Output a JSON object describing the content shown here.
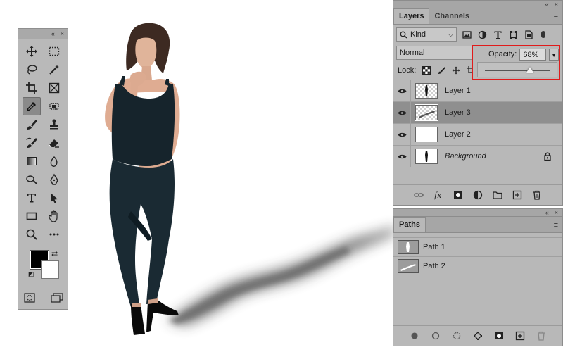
{
  "tools_panel": {
    "collapse_glyph": "«",
    "close_glyph": "×",
    "tools": [
      {
        "name": "move-tool-icon"
      },
      {
        "name": "rect-marquee-icon"
      },
      {
        "name": "lasso-icon"
      },
      {
        "name": "magic-wand-icon"
      },
      {
        "name": "crop-icon"
      },
      {
        "name": "frame-icon"
      },
      {
        "name": "eyedropper-icon",
        "active": true
      },
      {
        "name": "spot-healing-icon"
      },
      {
        "name": "brush-icon"
      },
      {
        "name": "clone-stamp-icon"
      },
      {
        "name": "history-brush-icon"
      },
      {
        "name": "eraser-icon"
      },
      {
        "name": "gradient-icon"
      },
      {
        "name": "blur-icon"
      },
      {
        "name": "dodge-icon"
      },
      {
        "name": "pen-icon"
      },
      {
        "name": "type-icon"
      },
      {
        "name": "path-selection-icon"
      },
      {
        "name": "rectangle-icon"
      },
      {
        "name": "hand-icon"
      },
      {
        "name": "zoom-icon"
      },
      {
        "name": "more-tools-icon"
      }
    ],
    "foreground_color": "#000000",
    "background_color": "#ffffff"
  },
  "layers_panel": {
    "collapse_glyph": "«",
    "close_glyph": "×",
    "tabs": [
      {
        "label": "Layers",
        "active": true
      },
      {
        "label": "Channels",
        "active": false
      }
    ],
    "filter_kind": "Kind",
    "blend_mode": "Normal",
    "opacity_label": "Opacity:",
    "opacity_value": "68%",
    "opacity_fraction": 0.68,
    "lock_label": "Lock:",
    "layers": [
      {
        "name": "Layer 1",
        "thumb": "checker-figure",
        "selected": false,
        "italic": false
      },
      {
        "name": "Layer 3",
        "thumb": "checker-shadow",
        "selected": true,
        "italic": false
      },
      {
        "name": "Layer 2",
        "thumb": "white",
        "selected": false,
        "italic": false
      },
      {
        "name": "Background",
        "thumb": "white-figure",
        "selected": false,
        "italic": true,
        "locked": true
      }
    ],
    "highlight_color": "#e01b1b"
  },
  "paths_panel": {
    "collapse_glyph": "«",
    "close_glyph": "×",
    "title": "Paths",
    "paths": [
      {
        "name": "Path 1"
      },
      {
        "name": "Path 2"
      }
    ]
  }
}
